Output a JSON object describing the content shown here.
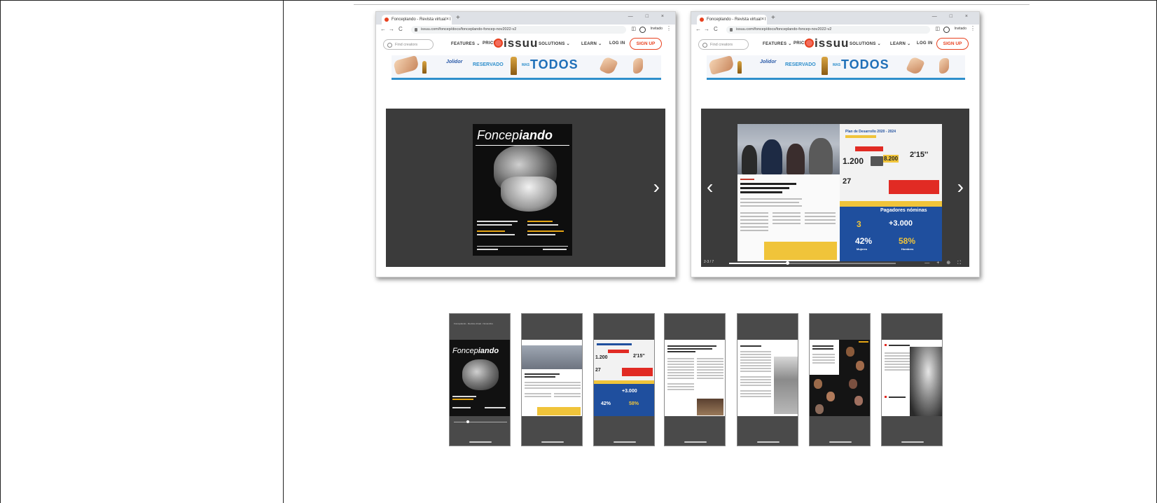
{
  "browser": {
    "tab_title": "Fonceplando - Revista virtual - I",
    "tab_close": "×",
    "new_tab": "+",
    "window_controls": "— □ ×",
    "back_icon": "←",
    "forward_icon": "→",
    "reload_icon": "C",
    "url": "issuu.com/foncep/docs/fonceplando-foncep-nov2022-v2",
    "profile_label": "Invitado",
    "menu_icon": "⋮"
  },
  "issuu": {
    "search_placeholder": "Find creators",
    "features": "FEATURES ⌄",
    "pricing": "PRICING",
    "solutions": "SOLUTIONS ⌄",
    "learn": "LEARN ⌄",
    "login": "LOG IN",
    "signup": "SIGN UP",
    "logo": "issuu"
  },
  "ad": {
    "brand": "Jolidor",
    "reservado": "RESERVADO",
    "mas": "MAS",
    "todos": "TODOS"
  },
  "viewer": {
    "prev_icon": "‹",
    "next_icon": "›",
    "page_indicator": "2-3 / 7",
    "zoom_controls": "— + ⊕ ⛶"
  },
  "cover": {
    "title_a": "Foncep",
    "title_b": "iando"
  },
  "spread": {
    "plan_title": "Plan de Desarrollo 2020 - 2024",
    "num_1200": "1.200",
    "num_8200": "8.200",
    "num_215": "2'15''",
    "num_27": "27",
    "pagadores": "Pagadores nóminas",
    "num_3": "3",
    "num_3000": "+3.000",
    "pct_42": "42%",
    "pct_58": "58%",
    "mujeres": "Mujeres",
    "hombres": "Hombres"
  },
  "thumbs": {
    "t1_header": "Fonceplando - Revista virtual - Noviembre",
    "t1_title_a": "Foncep",
    "t1_title_b": "iando",
    "t3_1200": "1.200",
    "t3_215": "2'15''",
    "t3_27": "27",
    "t3_3000": "+3.000",
    "t3_42": "42%",
    "t3_58": "58%"
  }
}
